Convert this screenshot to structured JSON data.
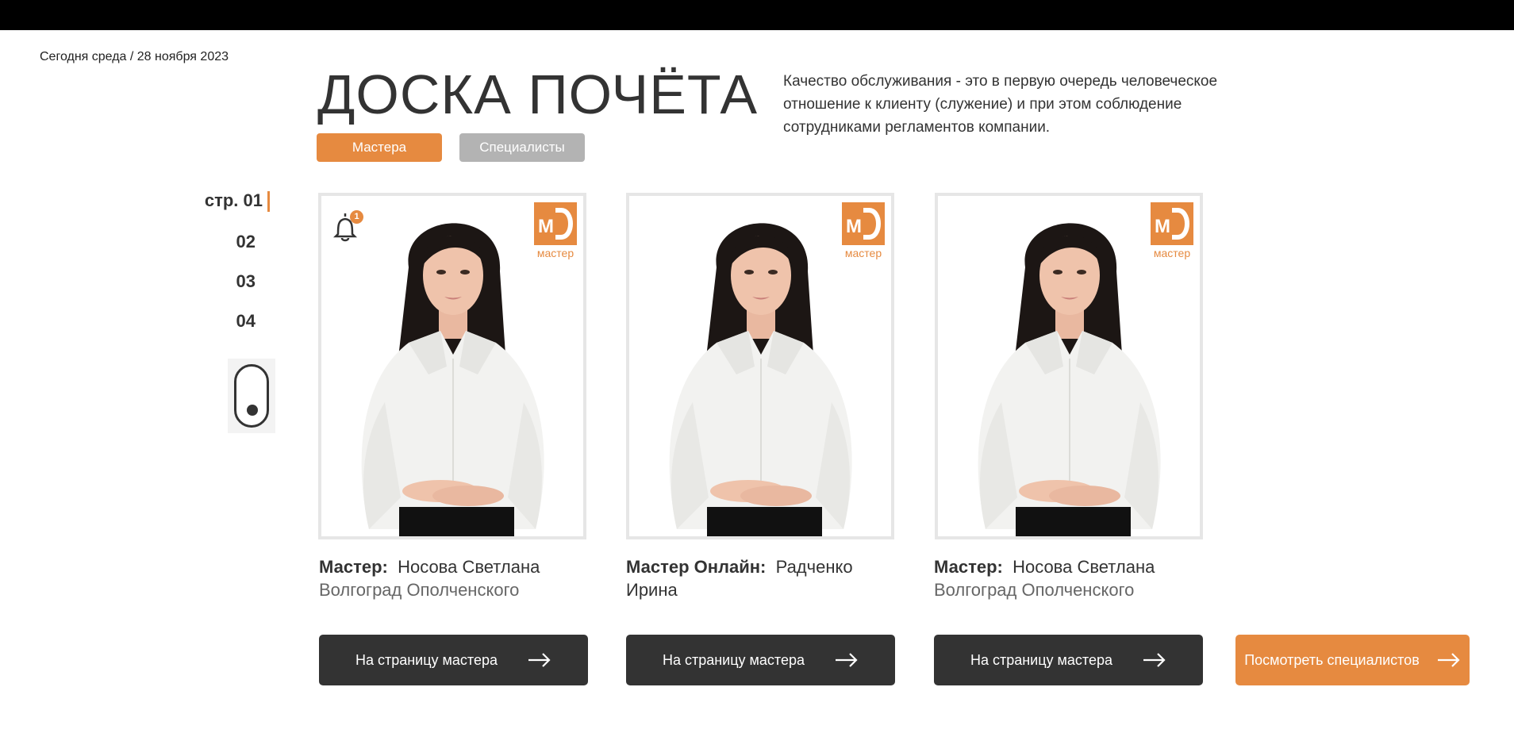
{
  "header": {
    "date": "Сегодня среда / 28 ноября 2023",
    "title": "ДОСКА ПОЧЁТА",
    "description": "Качество обслуживания - это в первую очередь человеческое отношение к клиенту (служение)  и при этом соблюдение сотрудниками регламентов компании."
  },
  "tabs": [
    {
      "label": "Мастера",
      "active": true
    },
    {
      "label": "Специалисты",
      "active": false
    }
  ],
  "pager": {
    "pages": [
      "стр. 01",
      "02",
      "03",
      "04"
    ],
    "current": "стр. 01"
  },
  "logo": {
    "text": "мастер",
    "letters": "M"
  },
  "cards": [
    {
      "role": "Мастер:",
      "person": "Носова Светлана",
      "city": "Волгоград Ополченского",
      "button": "На страницу мастера",
      "notification_count": "1",
      "icon": "bell-icon"
    },
    {
      "role": "Мастер Онлайн:",
      "person": "Радченко Ирина",
      "city": "",
      "button": "На страницу мастера"
    },
    {
      "role": "Мастер:",
      "person": "Носова Светлана",
      "city": "Волгоград Ополченского",
      "button": "На страницу мастера"
    }
  ],
  "cta": {
    "label": "Посмотреть специалистов",
    "icon": "arrow-right-icon"
  },
  "colors": {
    "accent": "#e68a40",
    "dark": "#333333",
    "inactive": "#b3b3b3",
    "topbar": "#000000"
  }
}
